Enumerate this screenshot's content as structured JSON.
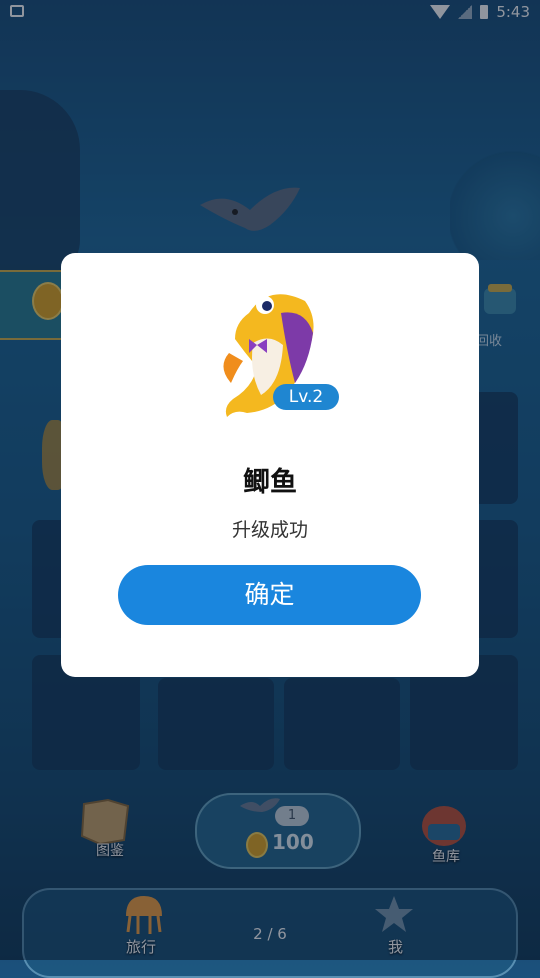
{
  "status_bar": {
    "time": "5:43"
  },
  "game": {
    "recycle_label": "回收",
    "atlas_label": "图鉴",
    "fish_library_label": "鱼库",
    "center_badge": "1",
    "coins": "100",
    "travel_label": "旅行",
    "me_label": "我",
    "page_indicator": "2 / 6"
  },
  "dialog": {
    "level": "Lv.2",
    "fish_name": "鲫鱼",
    "message": "升级成功",
    "confirm_label": "确定"
  },
  "colors": {
    "accent": "#1a86de",
    "dialog_bg": "#ffffff"
  }
}
